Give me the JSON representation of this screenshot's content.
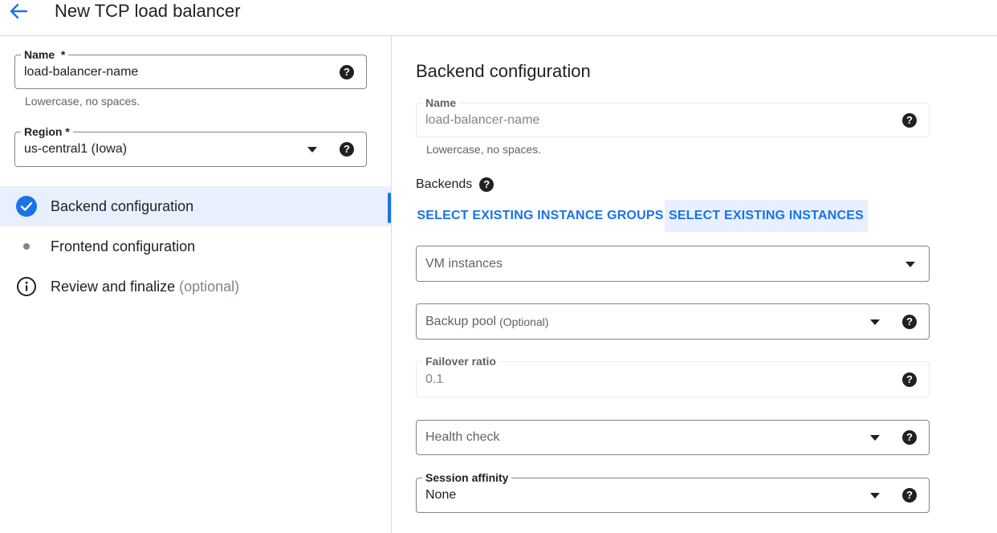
{
  "header": {
    "title": "New TCP load balancer"
  },
  "left": {
    "name_field": {
      "label": "Name",
      "required_mark": "*",
      "value": "load-balancer-name",
      "hint": "Lowercase, no spaces."
    },
    "region_field": {
      "label": "Region",
      "required_mark": "*",
      "value": "us-central1 (Iowa)"
    },
    "steps": [
      {
        "label": "Backend configuration",
        "optional": "",
        "status": "complete"
      },
      {
        "label": "Frontend configuration",
        "optional": "",
        "status": "pending"
      },
      {
        "label": "Review and finalize",
        "optional": "(optional)",
        "status": "info"
      }
    ]
  },
  "right": {
    "section_title": "Backend configuration",
    "name_field": {
      "label": "Name",
      "value": "load-balancer-name",
      "hint": "Lowercase, no spaces."
    },
    "backends_label": "Backends",
    "tabs": [
      {
        "label": "SELECT EXISTING INSTANCE GROUPS",
        "selected": false
      },
      {
        "label": "SELECT EXISTING INSTANCES",
        "selected": true
      }
    ],
    "vm_instances": {
      "placeholder": "VM instances"
    },
    "backup_pool": {
      "placeholder": "Backup pool",
      "optional": "(Optional)"
    },
    "failover_ratio": {
      "label": "Failover ratio",
      "value": "0.1"
    },
    "health_check": {
      "placeholder": "Health check"
    },
    "session_affinity": {
      "label": "Session affinity",
      "value": "None"
    }
  },
  "colors": {
    "accent": "#1a73e8",
    "active_bg": "#e8f0fe",
    "text": "#202124",
    "muted": "#5f6368",
    "border": "#80868b"
  },
  "icons": {
    "help": "?",
    "help_icon_name": "help-icon",
    "back_icon_name": "arrow-back-icon"
  }
}
